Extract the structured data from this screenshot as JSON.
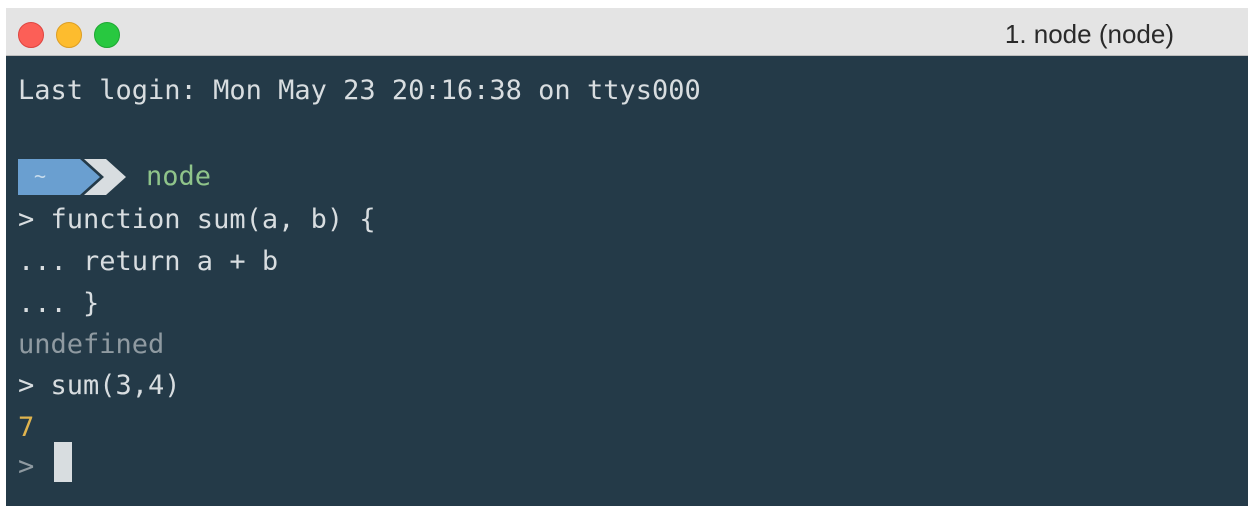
{
  "window": {
    "title": "1. node (node)"
  },
  "terminal": {
    "last_login": "Last login: Mon May 23 20:16:38 on ttys000",
    "prompt_badge": "~",
    "prompt_command": "node",
    "repl_lines": [
      "> function sum(a, b) {",
      "... return a + b",
      "... }"
    ],
    "result_1": "undefined",
    "input_2": "> sum(3,4)",
    "result_2": "7",
    "current_prompt": ">"
  },
  "colors": {
    "background": "#243a48",
    "text": "#d8dde0",
    "muted": "#8f9aa1",
    "number": "#e0b44e",
    "command": "#8fc48a",
    "prompt_badge": "#6a9fd0",
    "prompt_arrow": "#d8dde0"
  }
}
